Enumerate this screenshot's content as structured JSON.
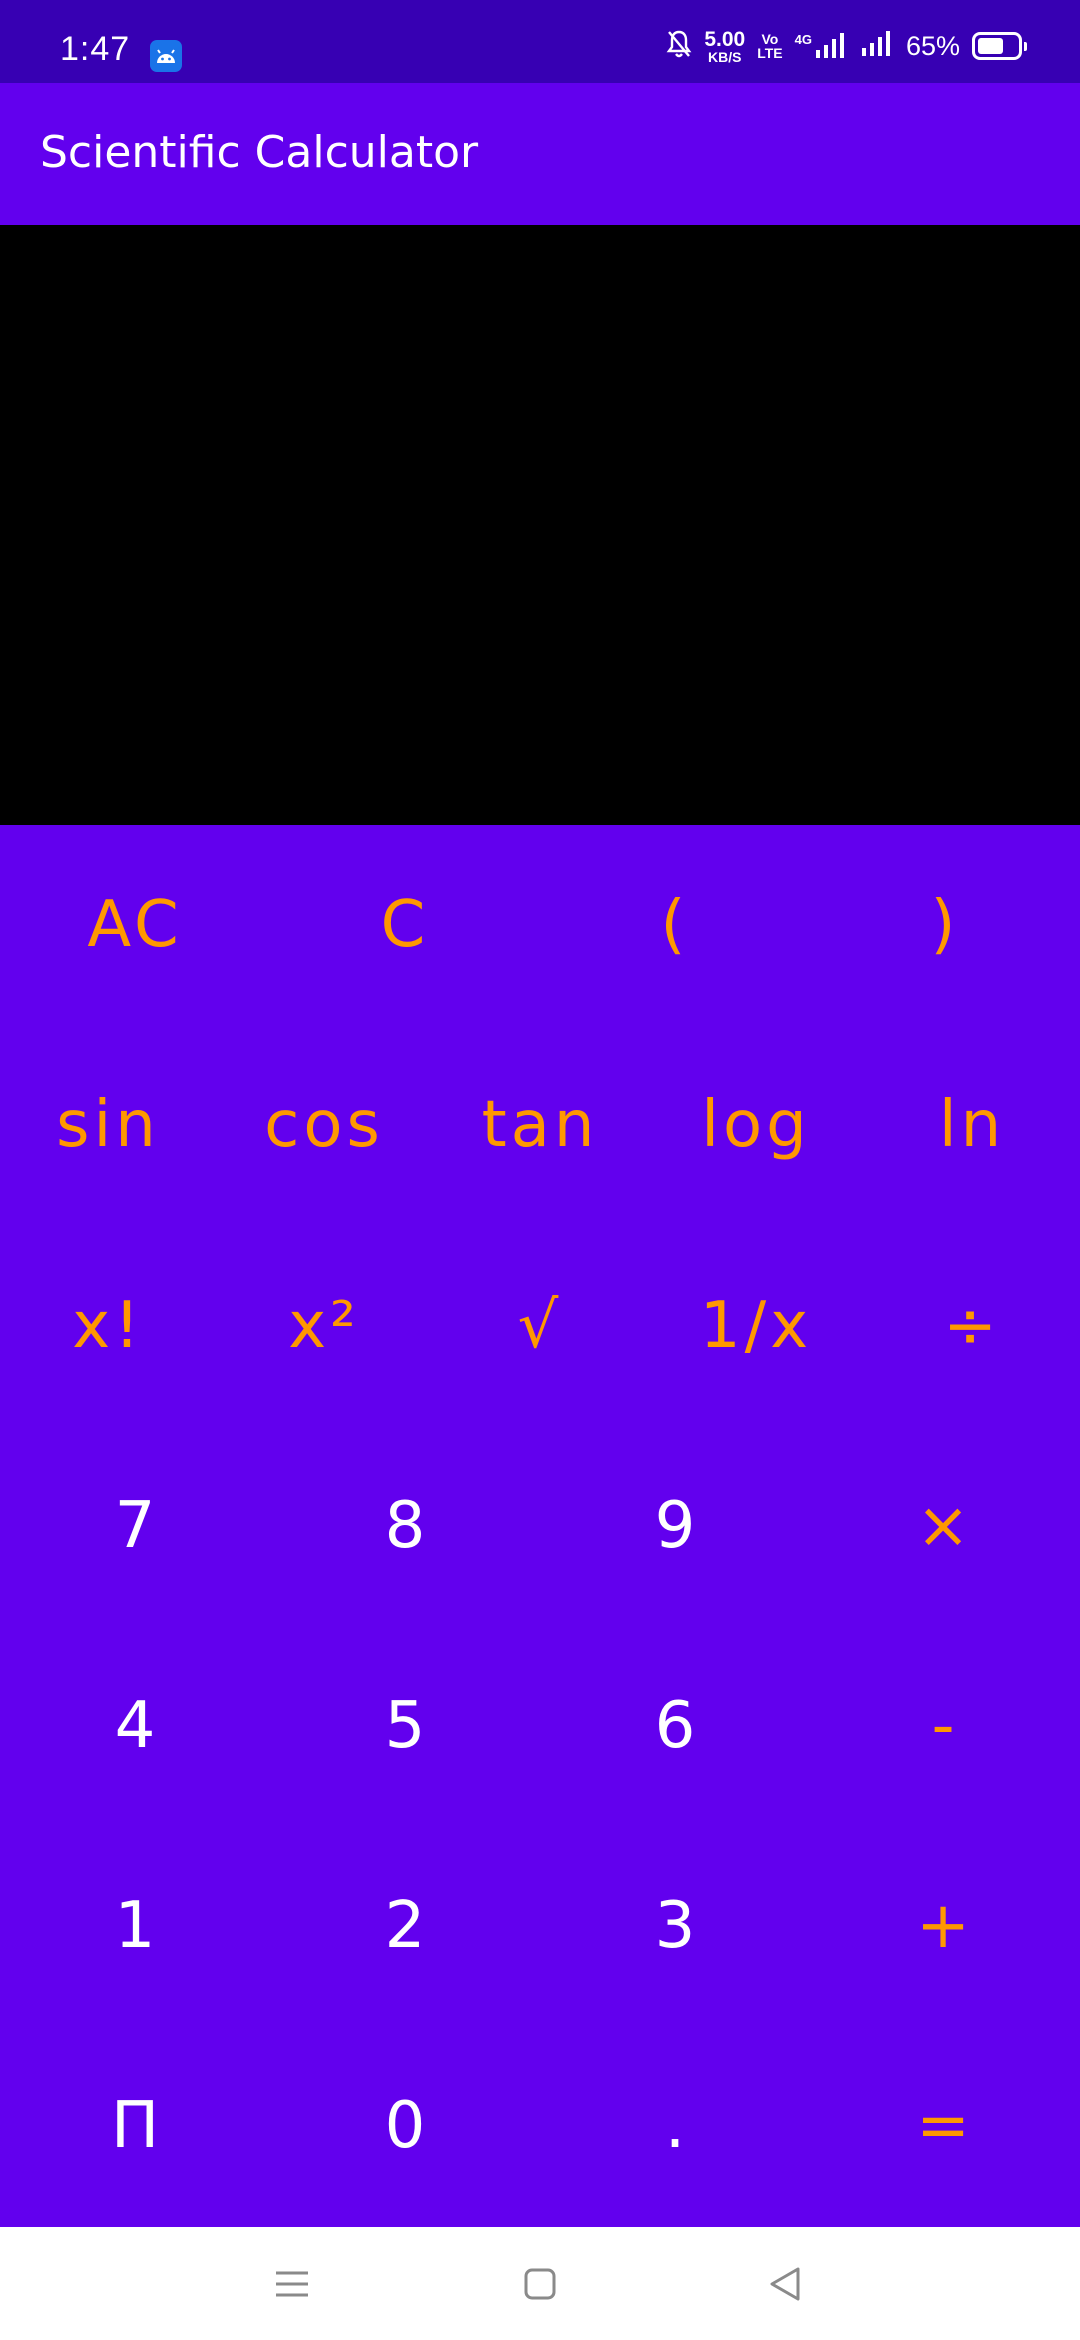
{
  "status_bar": {
    "time": "1:47",
    "net_speed_value": "5.00",
    "net_speed_unit": "KB/S",
    "volte_top": "Vo",
    "volte_bottom": "LTE",
    "network_label": "4G",
    "battery_percent": "65%",
    "battery_level": 0.65,
    "app_icon": "android-icon",
    "icons": [
      "mute-bell-icon",
      "signal-icon",
      "signal-icon",
      "battery-icon"
    ]
  },
  "app_bar": {
    "title": "Scientific Calculator"
  },
  "display": {
    "expression": "",
    "result": ""
  },
  "keypad": {
    "rows": [
      [
        {
          "label": "AC",
          "style": "fn",
          "name": "all-clear"
        },
        {
          "label": "C",
          "style": "fn",
          "name": "clear"
        },
        {
          "label": "(",
          "style": "fn",
          "name": "open-paren"
        },
        {
          "label": ")",
          "style": "fn",
          "name": "close-paren"
        }
      ],
      [
        {
          "label": "sin",
          "style": "fn",
          "name": "sin"
        },
        {
          "label": "cos",
          "style": "fn",
          "name": "cos"
        },
        {
          "label": "tan",
          "style": "fn",
          "name": "tan"
        },
        {
          "label": "log",
          "style": "fn",
          "name": "log"
        },
        {
          "label": "ln",
          "style": "fn",
          "name": "ln"
        }
      ],
      [
        {
          "label": "x!",
          "style": "fn",
          "name": "factorial"
        },
        {
          "label": "x²",
          "style": "fn",
          "name": "square"
        },
        {
          "label": "√",
          "style": "fn",
          "name": "square-root"
        },
        {
          "label": "1/x",
          "style": "fn",
          "name": "reciprocal"
        },
        {
          "label": "÷",
          "style": "fn",
          "name": "divide"
        }
      ],
      [
        {
          "label": "7",
          "style": "num",
          "name": "digit-7"
        },
        {
          "label": "8",
          "style": "num",
          "name": "digit-8"
        },
        {
          "label": "9",
          "style": "num",
          "name": "digit-9"
        },
        {
          "label": "×",
          "style": "fn",
          "name": "multiply"
        }
      ],
      [
        {
          "label": "4",
          "style": "num",
          "name": "digit-4"
        },
        {
          "label": "5",
          "style": "num",
          "name": "digit-5"
        },
        {
          "label": "6",
          "style": "num",
          "name": "digit-6"
        },
        {
          "label": "-",
          "style": "fn",
          "name": "subtract"
        }
      ],
      [
        {
          "label": "1",
          "style": "num",
          "name": "digit-1"
        },
        {
          "label": "2",
          "style": "num",
          "name": "digit-2"
        },
        {
          "label": "3",
          "style": "num",
          "name": "digit-3"
        },
        {
          "label": "+",
          "style": "fn",
          "name": "add"
        }
      ],
      [
        {
          "label": "Π",
          "style": "num",
          "name": "pi"
        },
        {
          "label": "0",
          "style": "num",
          "name": "digit-0"
        },
        {
          "label": ".",
          "style": "num",
          "name": "decimal-point"
        },
        {
          "label": "=",
          "style": "fn",
          "name": "equals"
        }
      ]
    ]
  },
  "nav_bar": {
    "icons": [
      "menu-icon",
      "home-icon",
      "back-icon"
    ]
  },
  "colors": {
    "status_bar": "#3700b3",
    "primary": "#6200ee",
    "display_bg": "#000000",
    "accent": "#ff9800",
    "digit": "#ffffff",
    "nav_bar": "#ffffff"
  }
}
